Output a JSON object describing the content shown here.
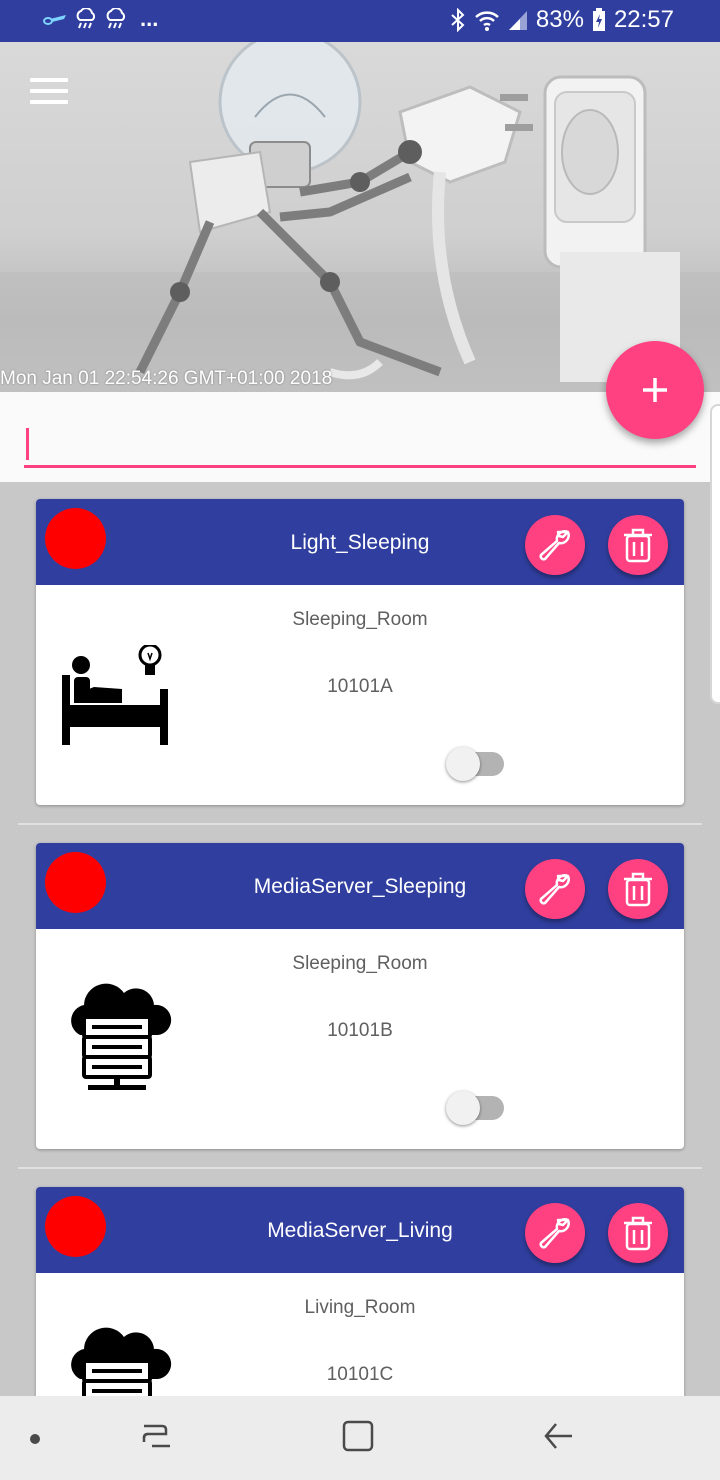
{
  "status_bar": {
    "battery": "83%",
    "time": "22:57",
    "overflow": "...",
    "icons": [
      "app-notification-icon",
      "rain-cloud-icon",
      "rain-cloud-icon",
      "bluetooth-icon",
      "wifi-icon",
      "signal-icon",
      "battery-charging-icon"
    ]
  },
  "header": {
    "menu_icon": "hamburger-menu-icon",
    "date_text": "Mon Jan 01 22:54:26 GMT+01:00 2018"
  },
  "search": {
    "placeholder": "",
    "value": ""
  },
  "fab": {
    "icon": "plus-icon"
  },
  "colors": {
    "primary": "#303f9f",
    "accent": "#ff4081",
    "status_off": "#ff0000"
  },
  "devices": [
    {
      "name": "Light_Sleeping",
      "room": "Sleeping_Room",
      "code": "10101A",
      "icon": "bed-light-icon",
      "enabled": false
    },
    {
      "name": "MediaServer_Sleeping",
      "room": "Sleeping_Room",
      "code": "10101B",
      "icon": "cloud-server-icon",
      "enabled": false
    },
    {
      "name": "MediaServer_Living",
      "room": "Living_Room",
      "code": "10101C",
      "icon": "cloud-server-icon",
      "enabled": false
    }
  ],
  "navbar": {
    "icons": [
      "dot-icon",
      "recent-apps-icon",
      "home-icon",
      "back-icon"
    ]
  }
}
